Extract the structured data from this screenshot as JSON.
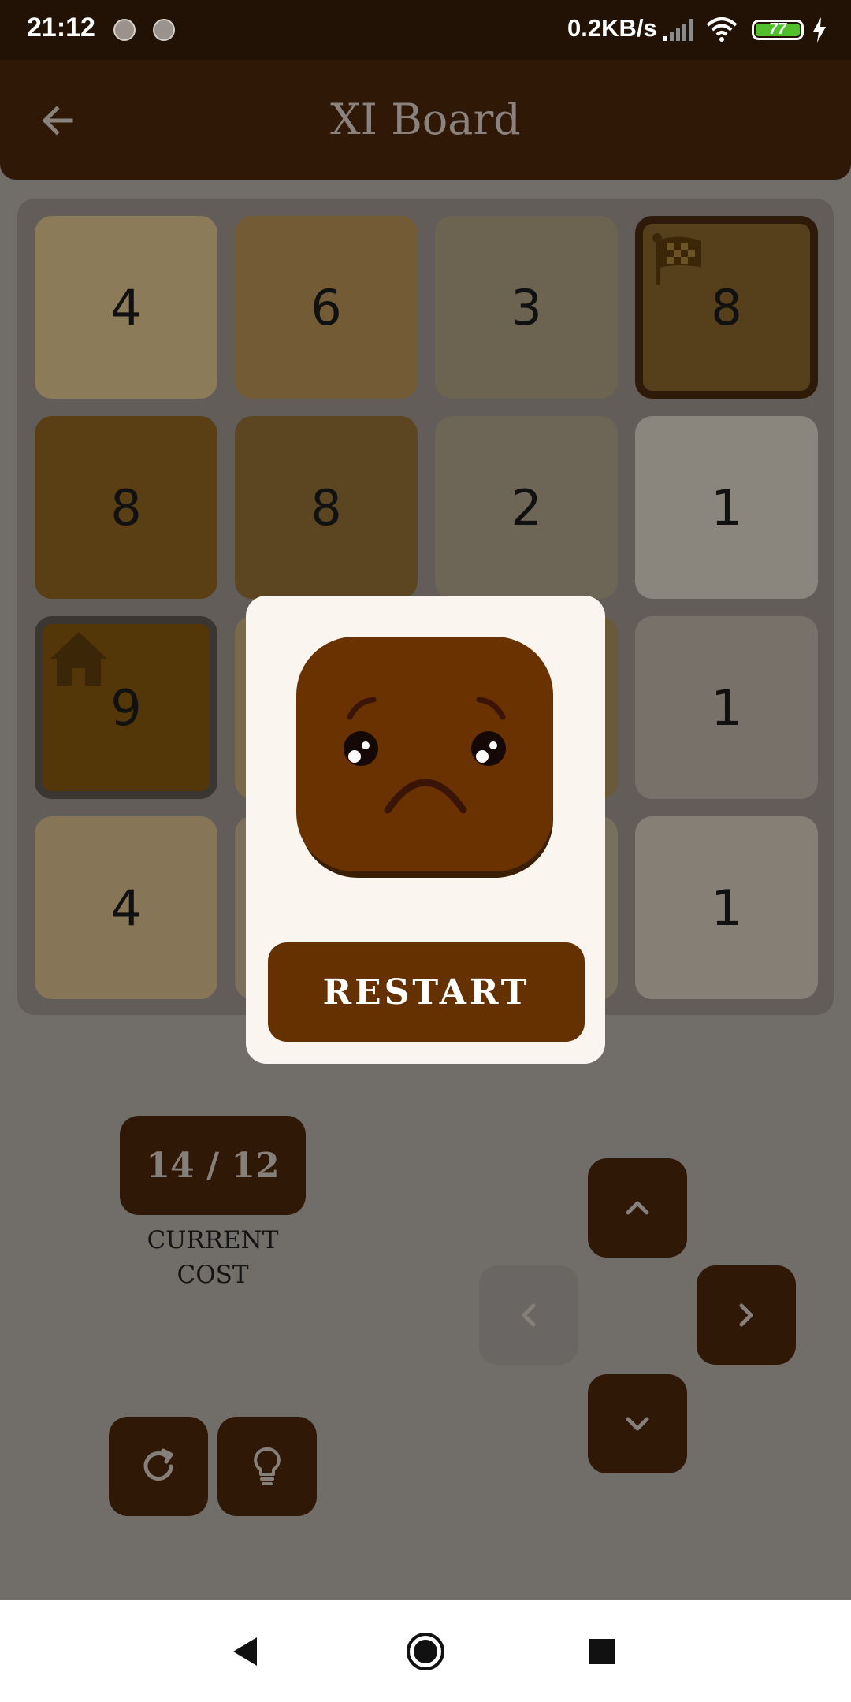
{
  "status_bar": {
    "time": "21:12",
    "network_rate": "0.2KB/s",
    "battery_level": "77",
    "battery_color": "#4fbf2c"
  },
  "app_bar": {
    "title": "XI Board",
    "back_icon": "arrow-left-icon"
  },
  "board": {
    "rows": 4,
    "cols": 4,
    "cells": [
      {
        "value": "4",
        "color": "#8b7b59"
      },
      {
        "value": "6",
        "color": "#735c35"
      },
      {
        "value": "3",
        "color": "#6c6450"
      },
      {
        "value": "8",
        "color": "#56401b",
        "marker": "goal",
        "icon": "checkered-flag-icon"
      },
      {
        "value": "8",
        "color": "#5b3f14"
      },
      {
        "value": "8",
        "color": "#5b4621"
      },
      {
        "value": "2",
        "color": "#6d6556"
      },
      {
        "value": "1",
        "color": "#8a857d"
      },
      {
        "value": "9",
        "color": "#533708",
        "marker": "start",
        "icon": "home-icon"
      },
      {
        "value": "",
        "color": "#7a6a4c"
      },
      {
        "value": "",
        "color": "#6b5a3a"
      },
      {
        "value": "1",
        "color": "#77716a"
      },
      {
        "value": "4",
        "color": "#867556"
      },
      {
        "value": "",
        "color": "#7a705c"
      },
      {
        "value": "",
        "color": "#77705f"
      },
      {
        "value": "1",
        "color": "#857f76"
      }
    ]
  },
  "modal": {
    "face_icon": "sad-face-icon",
    "restart_label": "RESTART"
  },
  "cost": {
    "value": "14 / 12",
    "label_line1": "CURRENT",
    "label_line2": "COST"
  },
  "controls": {
    "up_icon": "chevron-up-icon",
    "left_icon": "chevron-left-icon",
    "right_icon": "chevron-right-icon",
    "down_icon": "chevron-down-icon",
    "left_enabled": false,
    "restart_icon": "refresh-icon",
    "hint_icon": "lightbulb-icon"
  },
  "nav_bar": {
    "back_icon": "triangle-back-icon",
    "home_icon": "circle-home-icon",
    "recents_icon": "square-recents-icon"
  }
}
